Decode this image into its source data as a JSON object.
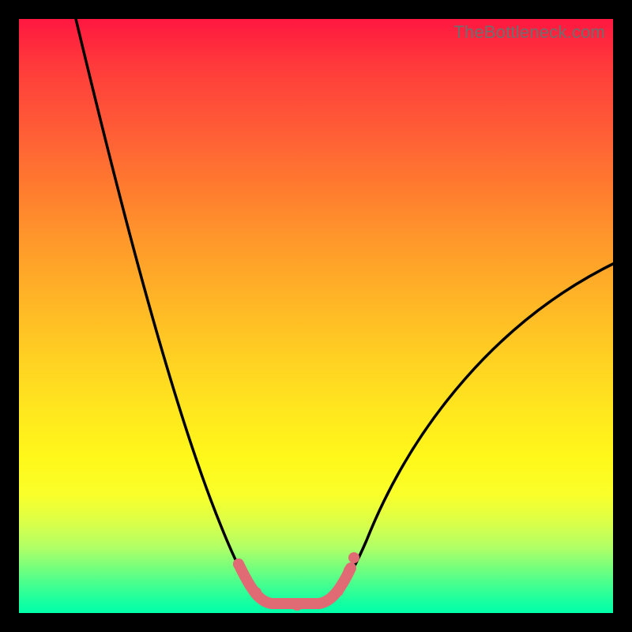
{
  "watermark": "TheBottleneck.com",
  "colors": {
    "curve": "#000000",
    "highlight": "#e06b74",
    "gradient_top": "#ff1740",
    "gradient_bottom": "#00ffaa",
    "frame": "#000000",
    "watermark_text": "#6e6e6e"
  },
  "chart_data": {
    "type": "line",
    "title": "",
    "xlabel": "",
    "ylabel": "",
    "xlim": [
      0,
      100
    ],
    "ylim": [
      0,
      100
    ],
    "note": "Axes have no visible tick labels; x/y are expressed as percentages of the plot area (0 = left/bottom, 100 = right/top). y corresponds to bottleneck percentage: high = bad (red), low = good (green).",
    "series": [
      {
        "name": "bottleneck-curve",
        "color": "#000000",
        "x": [
          10,
          15,
          20,
          25,
          30,
          34,
          38,
          42,
          45,
          48,
          51,
          55,
          60,
          66,
          74,
          82,
          90,
          100
        ],
        "y": [
          100,
          86,
          72,
          58,
          44,
          30,
          18,
          8,
          3,
          1.5,
          1.5,
          3,
          10,
          22,
          36,
          46,
          54,
          59
        ]
      },
      {
        "name": "optimal-range-highlight",
        "color": "#e06b74",
        "x": [
          37,
          40,
          43,
          47,
          51,
          54,
          56,
          57
        ],
        "y": [
          8.3,
          3.5,
          1.6,
          1.3,
          1.6,
          3.7,
          7.2,
          9.3
        ]
      }
    ]
  }
}
